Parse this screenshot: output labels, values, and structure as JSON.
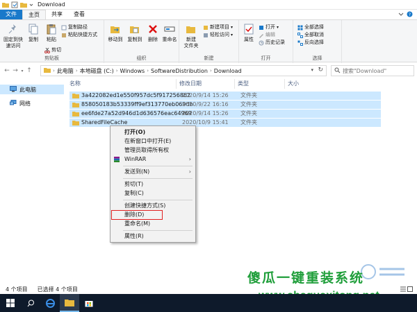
{
  "window": {
    "title": "Download"
  },
  "tabs": [
    "文件",
    "主页",
    "共享",
    "查看"
  ],
  "ribbon": {
    "clipboard": {
      "pin_label": "固定到快\n速访问",
      "copy_label": "复制",
      "paste_label": "粘贴",
      "copy_path_label": "复制路径",
      "paste_shortcut_label": "粘贴快捷方式",
      "cut_label": "剪切",
      "group_label": "剪贴板"
    },
    "organize": {
      "move_to_label": "移动到",
      "copy_to_label": "复制到",
      "delete_label": "删除",
      "rename_label": "重命名",
      "group_label": "组织"
    },
    "new": {
      "new_folder_label": "新建\n文件夹",
      "new_item_label": "新建项目",
      "easy_access_label": "轻松访问",
      "group_label": "新建"
    },
    "open": {
      "properties_label": "属性",
      "open_label": "打开",
      "edit_label": "编辑",
      "history_label": "历史记录",
      "group_label": "打开"
    },
    "select": {
      "select_all_label": "全部选择",
      "select_none_label": "全部取消",
      "invert_label": "反向选择",
      "group_label": "选择"
    }
  },
  "address": {
    "crumbs": [
      "此电脑",
      "本地磁盘 (C:)",
      "Windows",
      "SoftwareDistribution",
      "Download"
    ],
    "search_placeholder": "搜索\"Download\""
  },
  "navpane": {
    "items": [
      {
        "label": "此电脑",
        "selected": true
      },
      {
        "label": "网络",
        "selected": false
      }
    ]
  },
  "filelist": {
    "columns": [
      "名称",
      "修改日期",
      "类型",
      "大小"
    ],
    "rows": [
      {
        "name": "3a422082ed1e550f957dc5f917256862",
        "date": "2020/9/14 15:26",
        "type": "文件夹"
      },
      {
        "name": "858050183b53339ff9ef313770eb069db",
        "date": "2020/9/22 16:16",
        "type": "文件夹"
      },
      {
        "name": "ee6fde27a52d946d1d636576eac64969",
        "date": "2020/9/14 15:26",
        "type": "文件夹"
      },
      {
        "name": "SharedFileCache",
        "date": "2020/10/9 15:41",
        "type": "文件夹"
      }
    ]
  },
  "context_menu": {
    "items": [
      {
        "label": "打开(O)",
        "bold": true
      },
      {
        "label": "在新窗口中打开(E)"
      },
      {
        "label": "管理员取得所有权"
      },
      {
        "label": "WinRAR",
        "submenu": true
      },
      {
        "label": "发送到(N)",
        "submenu": true
      },
      {
        "label": "剪切(T)"
      },
      {
        "label": "复制(C)"
      },
      {
        "label": "创建快捷方式(S)"
      },
      {
        "label": "删除(D)",
        "highlighted": true
      },
      {
        "label": "重命名(M)"
      },
      {
        "label": "属性(R)"
      }
    ]
  },
  "statusbar": {
    "count": "4 个项目",
    "selected": "已选择 4 个项目"
  },
  "watermark": {
    "title": "傻瓜一键重装系统",
    "url": "www.shaguaxitong.net"
  },
  "colors": {
    "accent": "#1979ca",
    "selection": "#cce8ff",
    "folder": "#e8b93e",
    "delete_highlight": "#e02020",
    "watermark": "#1f9e3a",
    "taskbar": "#0e1a2b"
  }
}
